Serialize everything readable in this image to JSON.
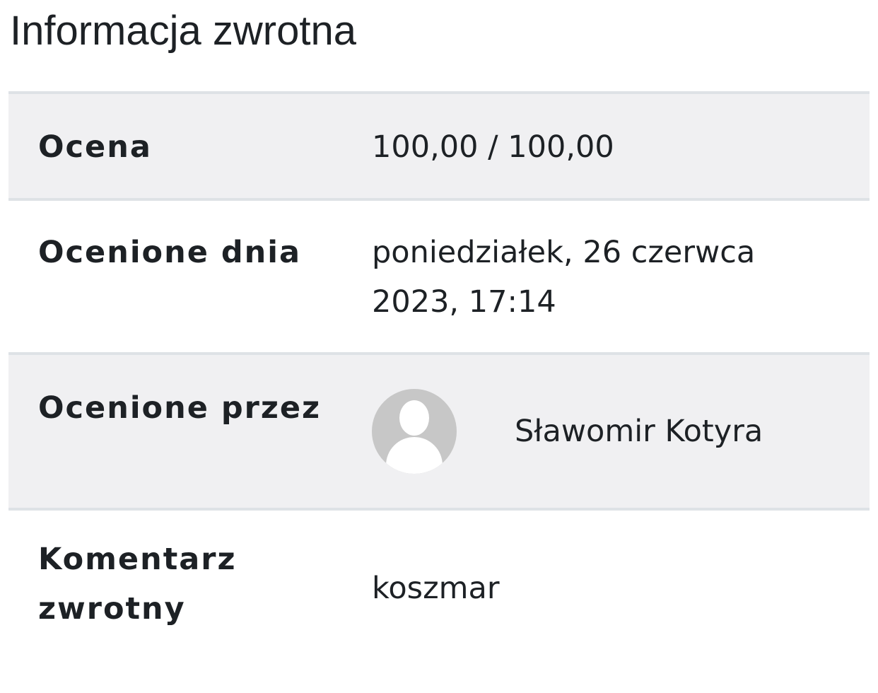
{
  "page": {
    "title": "Informacja zwrotna"
  },
  "feedback": {
    "grade": {
      "label": "Ocena",
      "value": "100,00 / 100,00"
    },
    "graded_on": {
      "label": "Ocenione dnia",
      "value": "poniedziałek, 26 czerwca 2023, 17:14"
    },
    "graded_by": {
      "label": "Ocenione przez",
      "avatar_icon": "default-user-avatar-icon",
      "name": "Sławomir Kotyra"
    },
    "comment": {
      "label": "Komentarz zwrotny",
      "value": "koszmar"
    }
  },
  "colors": {
    "text": "#1d2125",
    "row_shade": "#f0f0f2",
    "border": "#dee2e6",
    "avatar_bg": "#c7c7c7"
  }
}
